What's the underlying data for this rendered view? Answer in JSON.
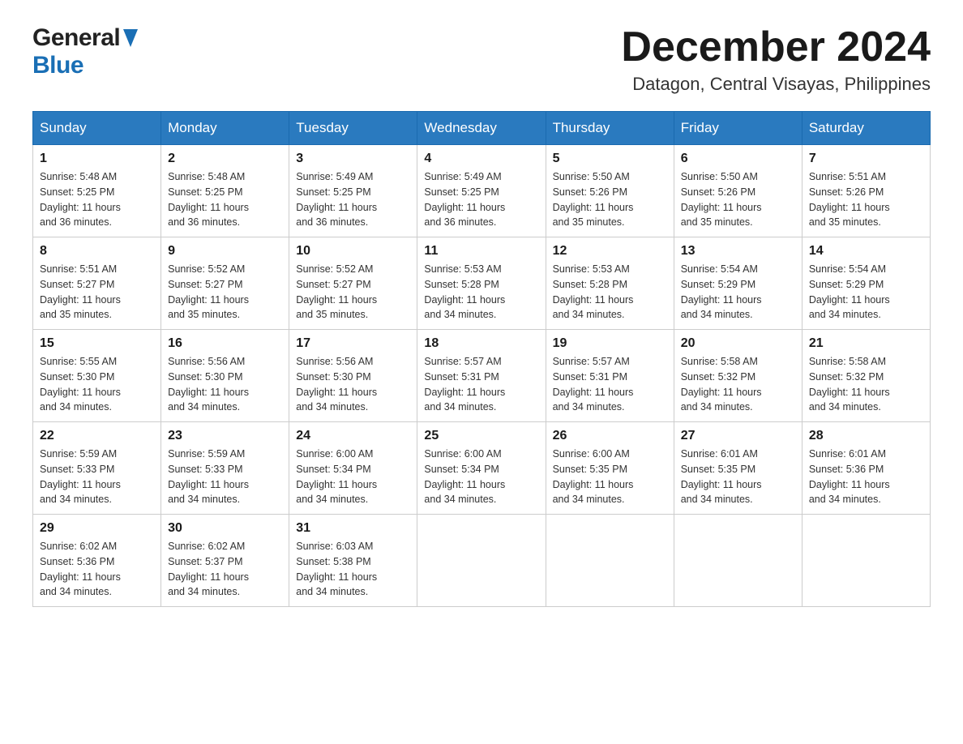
{
  "logo": {
    "general": "General",
    "blue": "Blue"
  },
  "header": {
    "month_year": "December 2024",
    "location": "Datagon, Central Visayas, Philippines"
  },
  "weekdays": [
    "Sunday",
    "Monday",
    "Tuesday",
    "Wednesday",
    "Thursday",
    "Friday",
    "Saturday"
  ],
  "weeks": [
    [
      {
        "day": "1",
        "sunrise": "5:48 AM",
        "sunset": "5:25 PM",
        "daylight": "11 hours and 36 minutes."
      },
      {
        "day": "2",
        "sunrise": "5:48 AM",
        "sunset": "5:25 PM",
        "daylight": "11 hours and 36 minutes."
      },
      {
        "day": "3",
        "sunrise": "5:49 AM",
        "sunset": "5:25 PM",
        "daylight": "11 hours and 36 minutes."
      },
      {
        "day": "4",
        "sunrise": "5:49 AM",
        "sunset": "5:25 PM",
        "daylight": "11 hours and 36 minutes."
      },
      {
        "day": "5",
        "sunrise": "5:50 AM",
        "sunset": "5:26 PM",
        "daylight": "11 hours and 35 minutes."
      },
      {
        "day": "6",
        "sunrise": "5:50 AM",
        "sunset": "5:26 PM",
        "daylight": "11 hours and 35 minutes."
      },
      {
        "day": "7",
        "sunrise": "5:51 AM",
        "sunset": "5:26 PM",
        "daylight": "11 hours and 35 minutes."
      }
    ],
    [
      {
        "day": "8",
        "sunrise": "5:51 AM",
        "sunset": "5:27 PM",
        "daylight": "11 hours and 35 minutes."
      },
      {
        "day": "9",
        "sunrise": "5:52 AM",
        "sunset": "5:27 PM",
        "daylight": "11 hours and 35 minutes."
      },
      {
        "day": "10",
        "sunrise": "5:52 AM",
        "sunset": "5:27 PM",
        "daylight": "11 hours and 35 minutes."
      },
      {
        "day": "11",
        "sunrise": "5:53 AM",
        "sunset": "5:28 PM",
        "daylight": "11 hours and 34 minutes."
      },
      {
        "day": "12",
        "sunrise": "5:53 AM",
        "sunset": "5:28 PM",
        "daylight": "11 hours and 34 minutes."
      },
      {
        "day": "13",
        "sunrise": "5:54 AM",
        "sunset": "5:29 PM",
        "daylight": "11 hours and 34 minutes."
      },
      {
        "day": "14",
        "sunrise": "5:54 AM",
        "sunset": "5:29 PM",
        "daylight": "11 hours and 34 minutes."
      }
    ],
    [
      {
        "day": "15",
        "sunrise": "5:55 AM",
        "sunset": "5:30 PM",
        "daylight": "11 hours and 34 minutes."
      },
      {
        "day": "16",
        "sunrise": "5:56 AM",
        "sunset": "5:30 PM",
        "daylight": "11 hours and 34 minutes."
      },
      {
        "day": "17",
        "sunrise": "5:56 AM",
        "sunset": "5:30 PM",
        "daylight": "11 hours and 34 minutes."
      },
      {
        "day": "18",
        "sunrise": "5:57 AM",
        "sunset": "5:31 PM",
        "daylight": "11 hours and 34 minutes."
      },
      {
        "day": "19",
        "sunrise": "5:57 AM",
        "sunset": "5:31 PM",
        "daylight": "11 hours and 34 minutes."
      },
      {
        "day": "20",
        "sunrise": "5:58 AM",
        "sunset": "5:32 PM",
        "daylight": "11 hours and 34 minutes."
      },
      {
        "day": "21",
        "sunrise": "5:58 AM",
        "sunset": "5:32 PM",
        "daylight": "11 hours and 34 minutes."
      }
    ],
    [
      {
        "day": "22",
        "sunrise": "5:59 AM",
        "sunset": "5:33 PM",
        "daylight": "11 hours and 34 minutes."
      },
      {
        "day": "23",
        "sunrise": "5:59 AM",
        "sunset": "5:33 PM",
        "daylight": "11 hours and 34 minutes."
      },
      {
        "day": "24",
        "sunrise": "6:00 AM",
        "sunset": "5:34 PM",
        "daylight": "11 hours and 34 minutes."
      },
      {
        "day": "25",
        "sunrise": "6:00 AM",
        "sunset": "5:34 PM",
        "daylight": "11 hours and 34 minutes."
      },
      {
        "day": "26",
        "sunrise": "6:00 AM",
        "sunset": "5:35 PM",
        "daylight": "11 hours and 34 minutes."
      },
      {
        "day": "27",
        "sunrise": "6:01 AM",
        "sunset": "5:35 PM",
        "daylight": "11 hours and 34 minutes."
      },
      {
        "day": "28",
        "sunrise": "6:01 AM",
        "sunset": "5:36 PM",
        "daylight": "11 hours and 34 minutes."
      }
    ],
    [
      {
        "day": "29",
        "sunrise": "6:02 AM",
        "sunset": "5:36 PM",
        "daylight": "11 hours and 34 minutes."
      },
      {
        "day": "30",
        "sunrise": "6:02 AM",
        "sunset": "5:37 PM",
        "daylight": "11 hours and 34 minutes."
      },
      {
        "day": "31",
        "sunrise": "6:03 AM",
        "sunset": "5:38 PM",
        "daylight": "11 hours and 34 minutes."
      },
      null,
      null,
      null,
      null
    ]
  ],
  "labels": {
    "sunrise": "Sunrise:",
    "sunset": "Sunset:",
    "daylight": "Daylight:"
  }
}
